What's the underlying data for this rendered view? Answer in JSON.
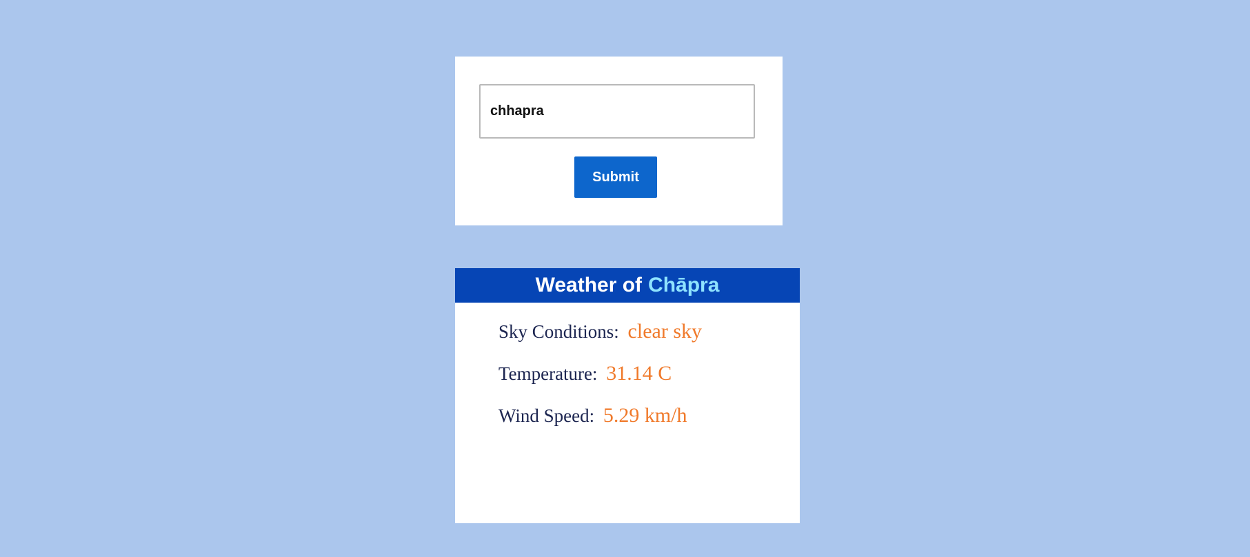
{
  "search": {
    "value": "chhapra",
    "submit_label": "Submit"
  },
  "weather": {
    "title_prefix": "Weather of",
    "city": "Chāpra",
    "rows": [
      {
        "label": "Sky Conditions:",
        "value": "clear sky"
      },
      {
        "label": "Temperature:",
        "value": "31.14 C"
      },
      {
        "label": "Wind Speed:",
        "value": "5.29 km/h"
      }
    ]
  },
  "colors": {
    "background": "#abc6ed",
    "header": "#0645b5",
    "city": "#8fe3ff",
    "button": "#0d66cc",
    "value": "#f07a2b"
  }
}
